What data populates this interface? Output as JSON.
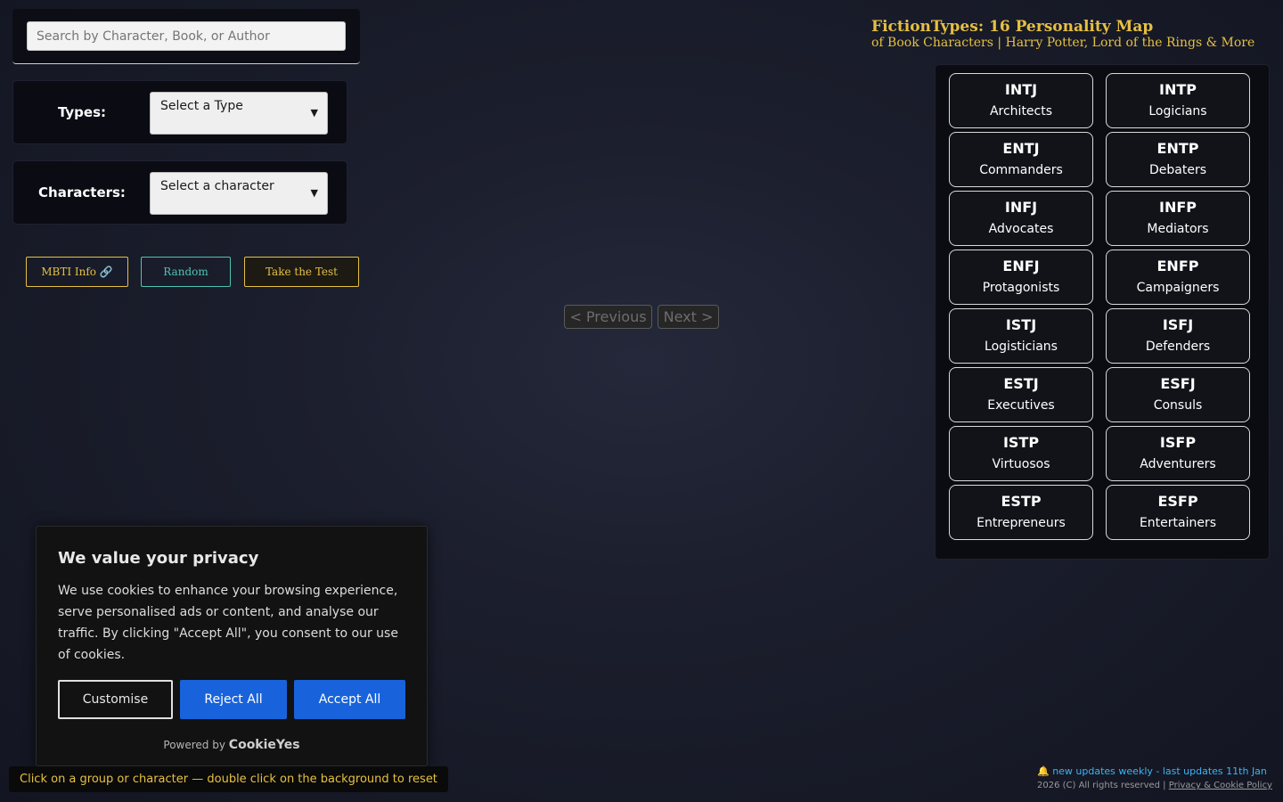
{
  "search": {
    "placeholder": "Search by Character, Book, or Author"
  },
  "filters": {
    "types_label": "Types:",
    "types_selected": "Select a Type",
    "characters_label": "Characters:",
    "characters_selected": "Select a character"
  },
  "actions": {
    "mbti_info": "MBTI Info 🔗",
    "random": "Random",
    "take_test": "Take the Test"
  },
  "pagination": {
    "previous": "< Previous",
    "next": "Next >"
  },
  "header": {
    "title": "FictionTypes: 16 Personality Map",
    "subtitle": "of Book Characters | Harry Potter, Lord of the Rings & More"
  },
  "types": [
    {
      "code": "INTJ",
      "name": "Architects"
    },
    {
      "code": "INTP",
      "name": "Logicians"
    },
    {
      "code": "ENTJ",
      "name": "Commanders"
    },
    {
      "code": "ENTP",
      "name": "Debaters"
    },
    {
      "code": "INFJ",
      "name": "Advocates"
    },
    {
      "code": "INFP",
      "name": "Mediators"
    },
    {
      "code": "ENFJ",
      "name": "Protagonists"
    },
    {
      "code": "ENFP",
      "name": "Campaigners"
    },
    {
      "code": "ISTJ",
      "name": "Logisticians"
    },
    {
      "code": "ISFJ",
      "name": "Defenders"
    },
    {
      "code": "ESTJ",
      "name": "Executives"
    },
    {
      "code": "ESFJ",
      "name": "Consuls"
    },
    {
      "code": "ISTP",
      "name": "Virtuosos"
    },
    {
      "code": "ISFP",
      "name": "Adventurers"
    },
    {
      "code": "ESTP",
      "name": "Entrepreneurs"
    },
    {
      "code": "ESFP",
      "name": "Entertainers"
    }
  ],
  "cookie": {
    "title": "We value your privacy",
    "text": "We use cookies to enhance your browsing experience, serve personalised ads or content, and analyse our traffic. By clicking \"Accept All\", you consent to our use of cookies.",
    "customise": "Customise",
    "reject": "Reject All",
    "accept": "Accept All",
    "powered_by": "Powered by",
    "brand": "CookieYes"
  },
  "hint": "Click on a group or character — double click on the background to reset",
  "footer": {
    "update": "🔔 new updates weekly - last updates 11th Jan",
    "copyright": "2026 (C) All rights reserved |",
    "policy_link": "Privacy & Cookie Policy"
  },
  "colors": {
    "accent_gold": "#e6c041",
    "accent_teal": "#4fc3b3",
    "cookie_blue": "#1863dc",
    "update_blue": "#3ab5f5"
  }
}
